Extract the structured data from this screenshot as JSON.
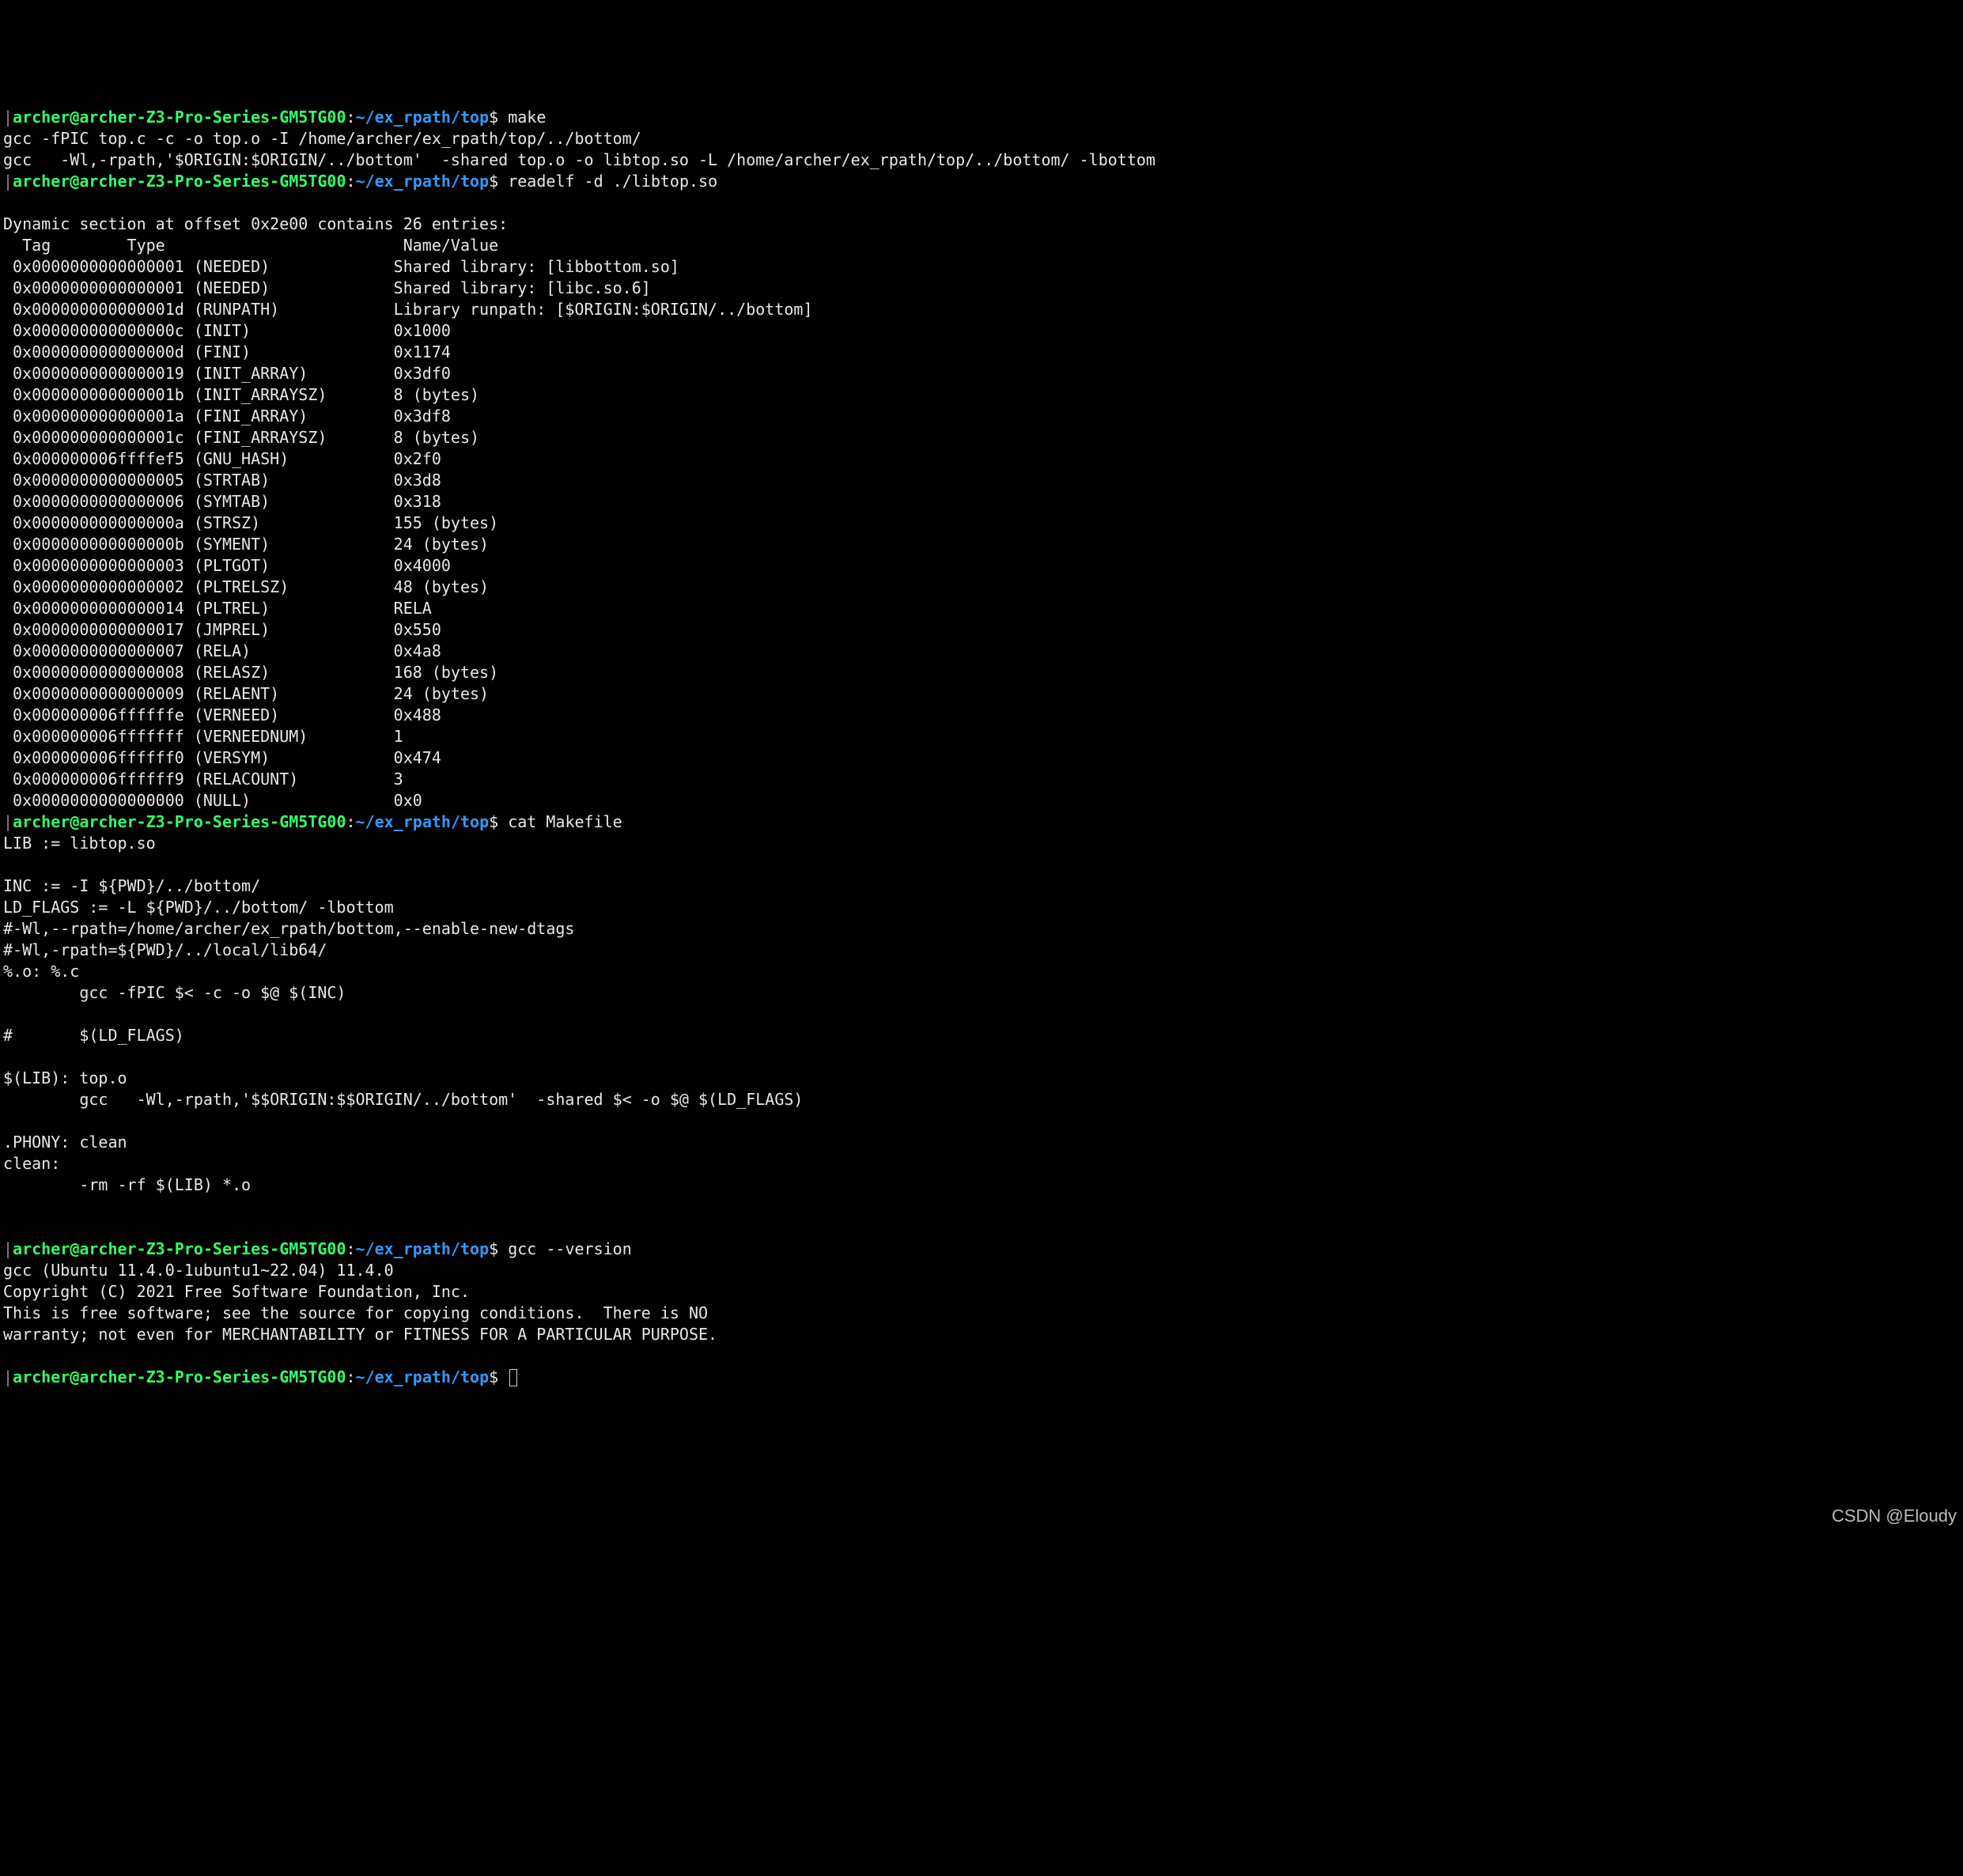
{
  "prompts": [
    {
      "user": "archer@archer-Z3-Pro-Series-GM5TG00",
      "sep": ":",
      "path": "~/ex_rpath/top",
      "dollar": "$",
      "cmd": "make"
    },
    {
      "user": "archer@archer-Z3-Pro-Series-GM5TG00",
      "sep": ":",
      "path": "~/ex_rpath/top",
      "dollar": "$",
      "cmd": "readelf -d ./libtop.so"
    },
    {
      "user": "archer@archer-Z3-Pro-Series-GM5TG00",
      "sep": ":",
      "path": "~/ex_rpath/top",
      "dollar": "$",
      "cmd": "cat Makefile"
    },
    {
      "user": "archer@archer-Z3-Pro-Series-GM5TG00",
      "sep": ":",
      "path": "~/ex_rpath/top",
      "dollar": "$",
      "cmd": "gcc --version"
    },
    {
      "user": "archer@archer-Z3-Pro-Series-GM5TG00",
      "sep": ":",
      "path": "~/ex_rpath/top",
      "dollar": "$",
      "cmd": ""
    }
  ],
  "make_output": {
    "line1": "gcc -fPIC top.c -c -o top.o -I /home/archer/ex_rpath/top/../bottom/",
    "line2": "gcc   -Wl,-rpath,'$ORIGIN:$ORIGIN/../bottom'  -shared top.o -o libtop.so -L /home/archer/ex_rpath/top/../bottom/ -lbottom"
  },
  "readelf": {
    "blank": "",
    "header": "Dynamic section at offset 0x2e00 contains 26 entries:",
    "cols": "  Tag        Type                         Name/Value",
    "rows": [
      " 0x0000000000000001 (NEEDED)             Shared library: [libbottom.so]",
      " 0x0000000000000001 (NEEDED)             Shared library: [libc.so.6]",
      " 0x000000000000001d (RUNPATH)            Library runpath: [$ORIGIN:$ORIGIN/../bottom]",
      " 0x000000000000000c (INIT)               0x1000",
      " 0x000000000000000d (FINI)               0x1174",
      " 0x0000000000000019 (INIT_ARRAY)         0x3df0",
      " 0x000000000000001b (INIT_ARRAYSZ)       8 (bytes)",
      " 0x000000000000001a (FINI_ARRAY)         0x3df8",
      " 0x000000000000001c (FINI_ARRAYSZ)       8 (bytes)",
      " 0x000000006ffffef5 (GNU_HASH)           0x2f0",
      " 0x0000000000000005 (STRTAB)             0x3d8",
      " 0x0000000000000006 (SYMTAB)             0x318",
      " 0x000000000000000a (STRSZ)              155 (bytes)",
      " 0x000000000000000b (SYMENT)             24 (bytes)",
      " 0x0000000000000003 (PLTGOT)             0x4000",
      " 0x0000000000000002 (PLTRELSZ)           48 (bytes)",
      " 0x0000000000000014 (PLTREL)             RELA",
      " 0x0000000000000017 (JMPREL)             0x550",
      " 0x0000000000000007 (RELA)               0x4a8",
      " 0x0000000000000008 (RELASZ)             168 (bytes)",
      " 0x0000000000000009 (RELAENT)            24 (bytes)",
      " 0x000000006ffffffe (VERNEED)            0x488",
      " 0x000000006fffffff (VERNEEDNUM)         1",
      " 0x000000006ffffff0 (VERSYM)             0x474",
      " 0x000000006ffffff9 (RELACOUNT)          3",
      " 0x0000000000000000 (NULL)               0x0"
    ]
  },
  "makefile": {
    "lines": [
      "LIB := libtop.so",
      "",
      "INC := -I ${PWD}/../bottom/",
      "LD_FLAGS := -L ${PWD}/../bottom/ -lbottom",
      "#-Wl,--rpath=/home/archer/ex_rpath/bottom,--enable-new-dtags",
      "#-Wl,-rpath=${PWD}/../local/lib64/",
      "%.o: %.c",
      "        gcc -fPIC $< -c -o $@ $(INC)",
      "",
      "#       $(LD_FLAGS)",
      "",
      "$(LIB): top.o",
      "        gcc   -Wl,-rpath,'$$ORIGIN:$$ORIGIN/../bottom'  -shared $< -o $@ $(LD_FLAGS)",
      "",
      ".PHONY: clean",
      "clean:",
      "        -rm -rf $(LIB) *.o",
      "",
      ""
    ]
  },
  "gccver": {
    "lines": [
      "gcc (Ubuntu 11.4.0-1ubuntu1~22.04) 11.4.0",
      "Copyright (C) 2021 Free Software Foundation, Inc.",
      "This is free software; see the source for copying conditions.  There is NO",
      "warranty; not even for MERCHANTABILITY or FITNESS FOR A PARTICULAR PURPOSE.",
      ""
    ]
  },
  "watermark": "CSDN @Eloudy"
}
